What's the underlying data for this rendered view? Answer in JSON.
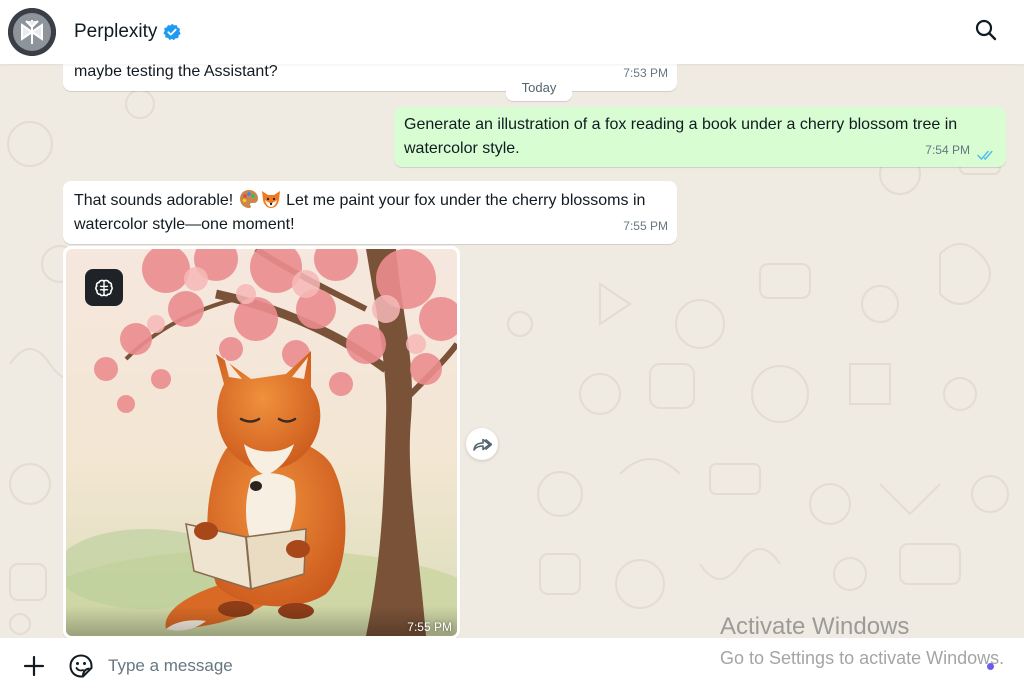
{
  "header": {
    "contact_name": "Perplexity",
    "verified": true
  },
  "messages": [
    {
      "direction": "in",
      "text": "maybe testing the Assistant?",
      "time": "7:53 PM"
    },
    {
      "direction": "out",
      "text": "Generate an illustration of a fox reading a book under a cherry blossom tree in watercolor style.",
      "time": "7:54 PM",
      "status": "read"
    },
    {
      "direction": "in",
      "text_before": "That sounds adorable! ",
      "emojis": [
        "palette-emoji",
        "fox-emoji"
      ],
      "text_after": " Let me paint your fox under the cherry blossoms in watercolor style—one moment!",
      "time": "7:55 PM"
    },
    {
      "direction": "in",
      "type": "image",
      "image_description": "watercolor fox reading a book under a cherry blossom tree",
      "time": "7:55 PM"
    }
  ],
  "date_separator": "Today",
  "composer": {
    "placeholder": "Type a message"
  },
  "watermark": {
    "line1": "Activate Windows",
    "line2": "Go to Settings to activate Windows."
  },
  "colors": {
    "chat_bg": "#efeae2",
    "outgoing_bubble": "#d9fdd3",
    "incoming_bubble": "#ffffff",
    "read_ticks": "#53bdeb",
    "verified_badge": "#1d9bf0"
  }
}
